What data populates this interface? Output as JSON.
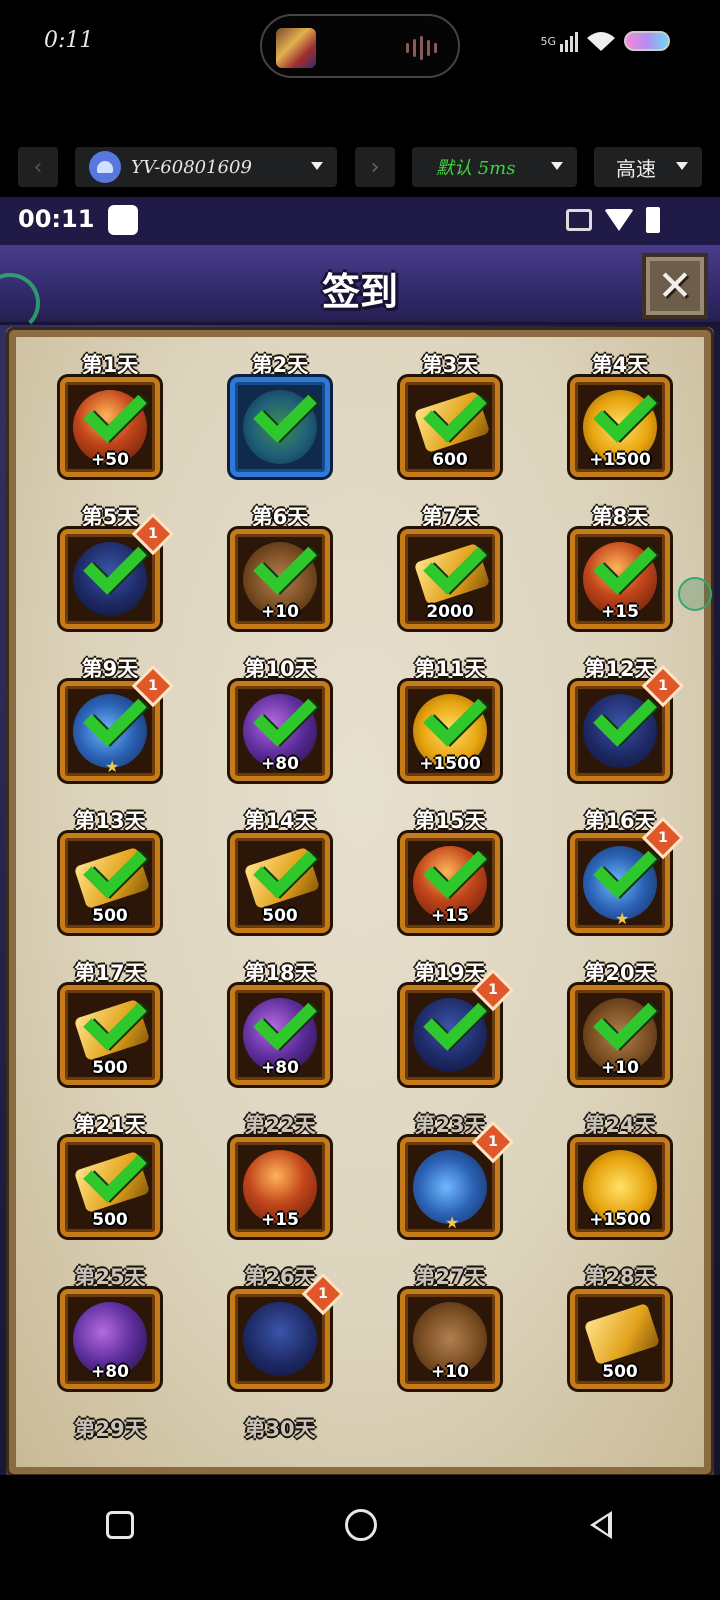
{
  "phone_status": {
    "time": "0:11",
    "network": "5G"
  },
  "toolbar": {
    "device_name": "YV-60801609",
    "latency_label": "默认 5ms",
    "speed_label": "高速"
  },
  "game_status": {
    "time": "00:11"
  },
  "dialog": {
    "title": "签到",
    "close_label": "✕"
  },
  "days": [
    {
      "label": "第1天",
      "value": "+50",
      "art": "fire",
      "checked": true,
      "badge": ""
    },
    {
      "label": "第2天",
      "value": "",
      "art": "wizard",
      "checked": true,
      "badge": "",
      "frame": "blue"
    },
    {
      "label": "第3天",
      "value": "600",
      "art": "gold",
      "checked": true,
      "badge": ""
    },
    {
      "label": "第4天",
      "value": "+1500",
      "art": "coin",
      "checked": true,
      "badge": ""
    },
    {
      "label": "第5天",
      "value": "",
      "art": "dragon",
      "checked": true,
      "badge": "1"
    },
    {
      "label": "第6天",
      "value": "+10",
      "art": "anvil",
      "checked": true,
      "badge": ""
    },
    {
      "label": "第7天",
      "value": "2000",
      "art": "gold",
      "checked": true,
      "badge": ""
    },
    {
      "label": "第8天",
      "value": "+15",
      "art": "fire",
      "checked": true,
      "badge": ""
    },
    {
      "label": "第9天",
      "value": "",
      "art": "gauntlet",
      "checked": true,
      "badge": "1",
      "star": true
    },
    {
      "label": "第10天",
      "value": "+80",
      "art": "galaxy",
      "checked": true,
      "badge": ""
    },
    {
      "label": "第11天",
      "value": "+1500",
      "art": "coin",
      "checked": true,
      "badge": ""
    },
    {
      "label": "第12天",
      "value": "",
      "art": "dragon",
      "checked": true,
      "badge": "1"
    },
    {
      "label": "第13天",
      "value": "500",
      "art": "gold",
      "checked": true,
      "badge": ""
    },
    {
      "label": "第14天",
      "value": "500",
      "art": "gold",
      "checked": true,
      "badge": ""
    },
    {
      "label": "第15天",
      "value": "+15",
      "art": "fire",
      "checked": true,
      "badge": ""
    },
    {
      "label": "第16天",
      "value": "",
      "art": "gauntlet",
      "checked": true,
      "badge": "1",
      "star": true
    },
    {
      "label": "第17天",
      "value": "500",
      "art": "gold",
      "checked": true,
      "badge": ""
    },
    {
      "label": "第18天",
      "value": "+80",
      "art": "galaxy",
      "checked": true,
      "badge": ""
    },
    {
      "label": "第19天",
      "value": "",
      "art": "dragon",
      "checked": true,
      "badge": "1"
    },
    {
      "label": "第20天",
      "value": "+10",
      "art": "anvil",
      "checked": true,
      "badge": ""
    },
    {
      "label": "第21天",
      "value": "500",
      "art": "gold",
      "checked": true,
      "badge": ""
    },
    {
      "label": "第22天",
      "value": "+15",
      "art": "fire",
      "checked": false,
      "badge": "",
      "dim": true
    },
    {
      "label": "第23天",
      "value": "",
      "art": "gauntlet",
      "checked": false,
      "badge": "1",
      "star": true,
      "dim": true
    },
    {
      "label": "第24天",
      "value": "+1500",
      "art": "coin",
      "checked": false,
      "badge": "",
      "dim": true
    },
    {
      "label": "第25天",
      "value": "+80",
      "art": "galaxy",
      "checked": false,
      "badge": "",
      "dim": true
    },
    {
      "label": "第26天",
      "value": "",
      "art": "dragon",
      "checked": false,
      "badge": "1",
      "dim": true
    },
    {
      "label": "第27天",
      "value": "+10",
      "art": "anvil",
      "checked": false,
      "badge": "",
      "dim": true
    },
    {
      "label": "第28天",
      "value": "500",
      "art": "gold",
      "checked": false,
      "badge": "",
      "dim": true
    },
    {
      "label": "第29天",
      "value": "",
      "art": "",
      "checked": false,
      "badge": "",
      "dim": true
    },
    {
      "label": "第30天",
      "value": "",
      "art": "",
      "checked": false,
      "badge": "",
      "dim": true
    }
  ],
  "colors": {
    "check": "#2ec82c",
    "frame": "#c57c18",
    "title_bar": "#3a2f78"
  }
}
